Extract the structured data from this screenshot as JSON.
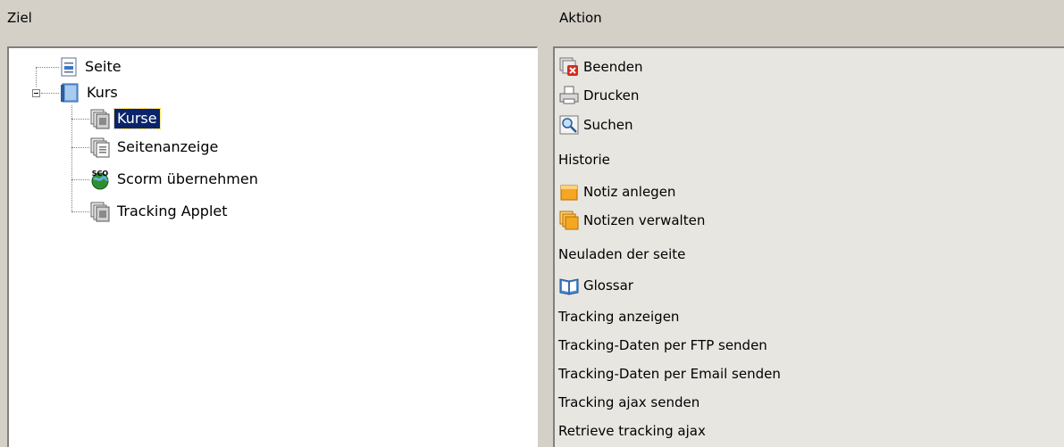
{
  "headers": {
    "left": "Ziel",
    "right": "Aktion"
  },
  "tree": {
    "items": [
      {
        "label": "Seite",
        "icon": "page-icon"
      },
      {
        "label": "Kurs",
        "icon": "book-icon"
      },
      {
        "label": "Kurse",
        "icon": "stacked-pages-icon",
        "selected": true
      },
      {
        "label": "Seitenanzeige",
        "icon": "stacked-pages-icon"
      },
      {
        "label": "Scorm übernehmen",
        "icon": "sco-globe-icon"
      },
      {
        "label": "Tracking Applet",
        "icon": "stacked-pages-icon"
      }
    ]
  },
  "actions": {
    "items": [
      {
        "label": "Beenden",
        "icon": "close-window-icon"
      },
      {
        "label": "Drucken",
        "icon": "printer-icon"
      },
      {
        "label": "Suchen",
        "icon": "search-icon"
      },
      {
        "label": "Historie",
        "icon": ""
      },
      {
        "label": "Notiz anlegen",
        "icon": "note-icon"
      },
      {
        "label": "Notizen verwalten",
        "icon": "notes-stack-icon"
      },
      {
        "label": "Neuladen der seite",
        "icon": ""
      },
      {
        "label": "Glossar",
        "icon": "glossary-book-icon"
      },
      {
        "label": "Tracking anzeigen",
        "icon": ""
      },
      {
        "label": "Tracking-Daten per FTP senden",
        "icon": ""
      },
      {
        "label": "Tracking-Daten per Email senden",
        "icon": ""
      },
      {
        "label": "Tracking ajax senden",
        "icon": ""
      },
      {
        "label": "Retrieve tracking ajax",
        "icon": ""
      }
    ]
  }
}
